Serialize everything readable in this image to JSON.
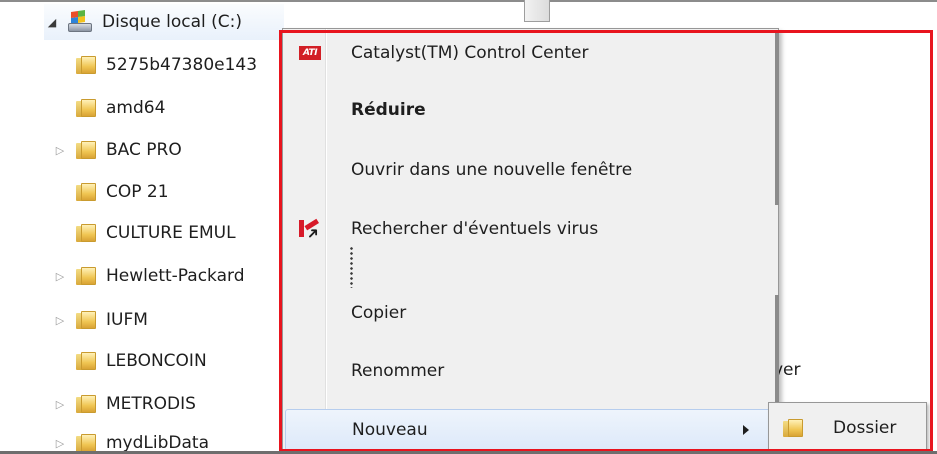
{
  "tree": {
    "root": {
      "label": "Disque local (C:)",
      "icon": "drive-icon",
      "expanded": true
    },
    "items": [
      {
        "label": "5275b47380e143",
        "has_children": false
      },
      {
        "label": "amd64",
        "has_children": false
      },
      {
        "label": "BAC PRO",
        "has_children": true
      },
      {
        "label": "COP 21",
        "has_children": false
      },
      {
        "label": "CULTURE EMUL",
        "has_children": false
      },
      {
        "label": "Hewlett-Packard",
        "has_children": true
      },
      {
        "label": "IUFM",
        "has_children": true
      },
      {
        "label": "LEBONCOIN",
        "has_children": false
      },
      {
        "label": "METRODIS",
        "has_children": true
      },
      {
        "label": "mydLibData",
        "has_children": true
      }
    ],
    "partial_text": "ver"
  },
  "context_menu": {
    "items": [
      {
        "label": "Catalyst(TM) Control Center",
        "icon": "ati-icon",
        "bold": false
      },
      {
        "label": "Réduire",
        "icon": null,
        "bold": true
      },
      {
        "label": "Ouvrir dans une nouvelle fenêtre",
        "icon": null,
        "bold": false
      },
      {
        "label": "Rechercher d'éventuels virus",
        "icon": "kaspersky-icon",
        "bold": false
      },
      {
        "label": "Copier",
        "icon": null,
        "bold": false
      },
      {
        "label": "Renommer",
        "icon": null,
        "bold": false
      },
      {
        "label": "Nouveau",
        "icon": null,
        "bold": false,
        "submenu": true,
        "highlighted": true
      }
    ],
    "ati_badge_text": "ATI"
  },
  "submenu": {
    "items": [
      {
        "label": "Dossier",
        "icon": "folder-icon"
      }
    ]
  },
  "colors": {
    "annotation": "#e8141e",
    "menu_background": "#f0f0f0",
    "highlight": "#dde9f9"
  }
}
